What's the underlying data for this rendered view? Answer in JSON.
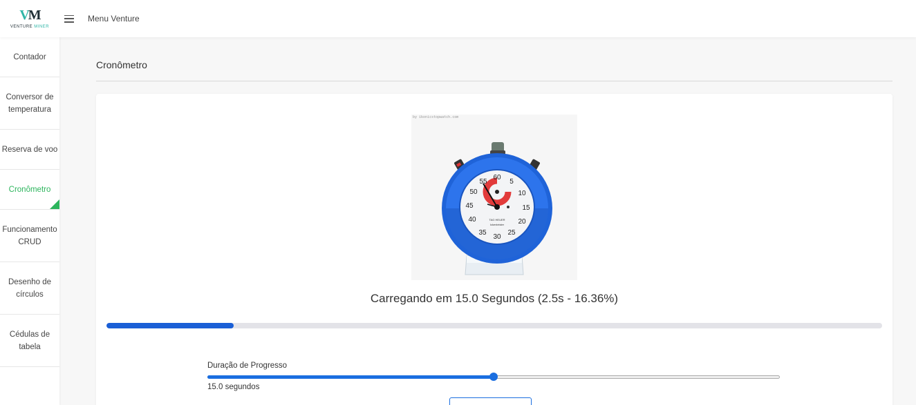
{
  "header": {
    "logo_mark_left": "V",
    "logo_mark_right": "M",
    "logo_word_1": "VENTURE",
    "logo_word_2": "MINER",
    "menu_title": "Menu Venture"
  },
  "sidebar": {
    "items": [
      {
        "label": "Contador",
        "active": false
      },
      {
        "label": "Conversor de\ntemperatura",
        "active": false
      },
      {
        "label": "Reserva de voo",
        "active": false
      },
      {
        "label": "Cronômetro",
        "active": true
      },
      {
        "label": "Funcionamento\nCRUD",
        "active": false
      },
      {
        "label": "Desenho de\ncírculos",
        "active": false
      },
      {
        "label": "Cédulas de\ntabela",
        "active": false
      }
    ],
    "active_color": "#2db55d"
  },
  "main": {
    "page_title": "Cronômetro",
    "image_watermark": "by ikonicstopwatch.com",
    "dial": {
      "numerals": [
        "60",
        "5",
        "10",
        "15",
        "20",
        "25",
        "30",
        "35",
        "40",
        "45",
        "50",
        "55"
      ],
      "brand": "TAG HEUER",
      "model": "Ickenleister"
    },
    "loading_text": "Carregando em 15.0 Segundos (2.5s - 16.36%)",
    "progress_percent": 16.36,
    "progress_color": "#1a5fd6",
    "duration_label": "Duração de Progresso",
    "duration_slider": {
      "value": 15.0,
      "min": 0,
      "max": 30,
      "color": "#1a6ee0"
    },
    "duration_value_text": "15.0 segundos"
  }
}
